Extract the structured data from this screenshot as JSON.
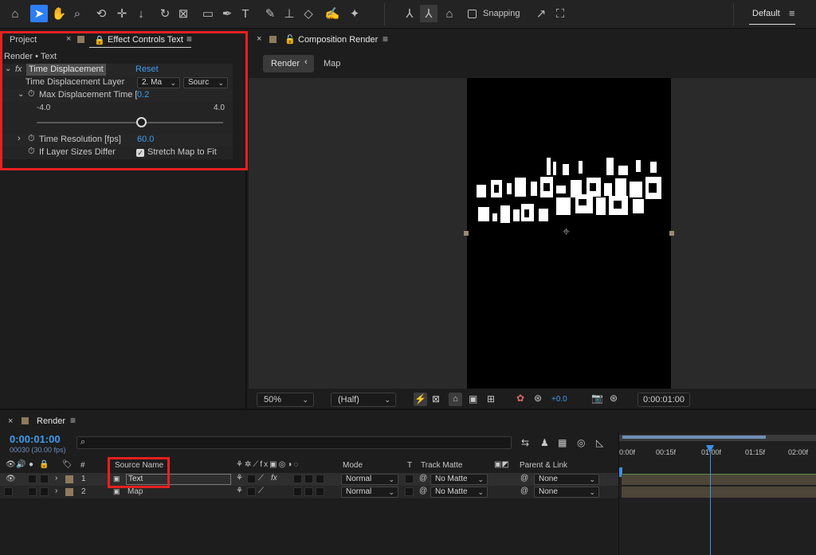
{
  "workspace": {
    "label": "Default"
  },
  "toolbar": {
    "snapping_label": "Snapping"
  },
  "left_panel": {
    "project_tab": "Project",
    "effect_controls_tab": "Effect Controls Text",
    "breadcrumb": "Render • Text",
    "effect": {
      "name": "Time Displacement",
      "reset": "Reset",
      "layer_label": "Time Displacement Layer",
      "layer_value": "2. Ma",
      "source_value": "Sourc",
      "max_disp_label": "Max Displacement Time [",
      "max_disp_value": "0.2",
      "slider_min": "-4.0",
      "slider_max": "4.0",
      "time_res_label": "Time Resolution [fps]",
      "time_res_value": "60.0",
      "sizes_label": "If Layer Sizes Differ",
      "stretch_label": "Stretch Map to Fit"
    }
  },
  "comp_panel": {
    "title": "Composition Render",
    "breadcrumb_active": "Render",
    "breadcrumb_next": "Map",
    "zoom": "50%",
    "resolution": "(Half)",
    "exposure": "+0.0",
    "timecode": "0:00:01:00"
  },
  "timeline": {
    "tab": "Render",
    "timecode": "0:00:01:00",
    "frame_info": "00030 (30.00 fps)",
    "columns": {
      "num": "#",
      "source_name": "Source Name",
      "mode": "Mode",
      "t": "T",
      "track_matte": "Track Matte",
      "parent": "Parent & Link"
    },
    "rows": [
      {
        "num": "1",
        "name": "Text",
        "mode": "Normal",
        "matte": "No Matte",
        "parent": "None"
      },
      {
        "num": "2",
        "name": "Map",
        "mode": "Normal",
        "matte": "No Matte",
        "parent": "None"
      }
    ],
    "ruler": [
      "0:00f",
      "00:15f",
      "01:00f",
      "01:15f",
      "02:00f"
    ]
  }
}
